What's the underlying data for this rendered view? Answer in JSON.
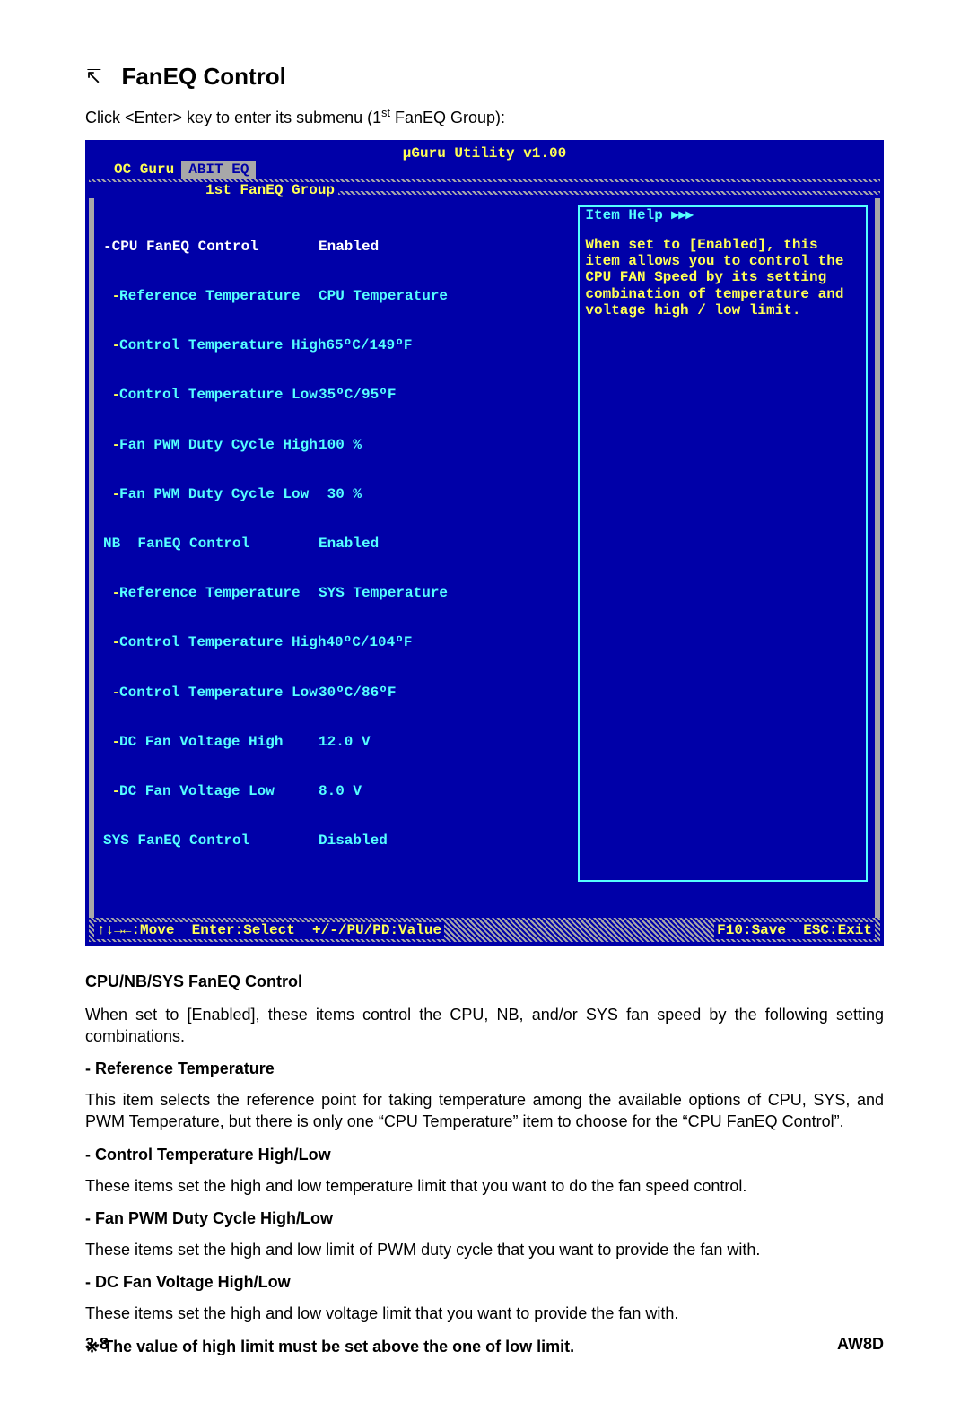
{
  "heading": "FanEQ Control",
  "intro_prefix": "Click <Enter> key to enter its submenu (1",
  "intro_super": "st",
  "intro_suffix": " FanEQ Group):",
  "bios": {
    "title": "μGuru Utility v1.00",
    "tab_inactive": "OC Guru",
    "tab_active": "ABIT EQ",
    "subtitle": "1st FanEQ Group",
    "rows": [
      {
        "indent": "",
        "label": "-CPU FanEQ Control",
        "value": "Enabled",
        "hl": true
      },
      {
        "indent": " - ",
        "label": "Reference Temperature",
        "value": "CPU Temperature"
      },
      {
        "indent": " - ",
        "label": "Control Temperature High",
        "value": "65ºC/149ºF"
      },
      {
        "indent": " - ",
        "label": "Control Temperature Low",
        "value": "35ºC/95ºF"
      },
      {
        "indent": " - ",
        "label": "Fan PWM Duty Cycle High",
        "value": "100 %"
      },
      {
        "indent": " - ",
        "label": "Fan PWM Duty Cycle Low",
        "value": " 30 %"
      },
      {
        "indent": "",
        "label": "NB  FanEQ Control",
        "value": "Enabled"
      },
      {
        "indent": " - ",
        "label": "Reference Temperature",
        "value": "SYS Temperature"
      },
      {
        "indent": " - ",
        "label": "Control Temperature High",
        "value": "40ºC/104ºF"
      },
      {
        "indent": " - ",
        "label": "Control Temperature Low",
        "value": "30ºC/86ºF"
      },
      {
        "indent": " - ",
        "label": "DC Fan Voltage High",
        "value": "12.0 V"
      },
      {
        "indent": " - ",
        "label": "DC Fan Voltage Low",
        "value": "8.0 V"
      },
      {
        "indent": "",
        "label": "SYS FanEQ Control",
        "value": "Disabled"
      }
    ],
    "help_title": "Item Help ▸▸▸",
    "help_body": "When set to [Enabled], this item allows you to control the CPU FAN Speed by its setting combination of temperature and voltage high / low limit.",
    "footer_left": "↑↓→←:Move  Enter:Select  +/-/PU/PD:Value",
    "footer_right": "F10:Save  ESC:Exit"
  },
  "doc": {
    "h_main": "CPU/NB/SYS FanEQ Control",
    "p_main": "When set to [Enabled], these items control the CPU, NB, and/or SYS fan speed by the following setting combinations.",
    "h_ref": "-   Reference Temperature",
    "p_ref": "This item selects the reference point for taking temperature among the available options of CPU, SYS, and PWM Temperature, but there is only one “CPU Temperature” item to choose for the “CPU FanEQ Control”.",
    "h_ctl": "-   Control Temperature High/Low",
    "p_ctl": "These items set the high and low temperature limit that you want to do the fan speed control.",
    "h_pwm": "-   Fan PWM Duty Cycle High/Low",
    "p_pwm": "These items set the high and low limit of PWM duty cycle that you want to provide the fan with.",
    "h_dc": "-   DC Fan Voltage High/Low",
    "p_dc": "These items set the high and low voltage limit that you want to provide the fan with.",
    "note": "※  The value of high limit must be set above the one of low limit."
  },
  "footer": {
    "left": "3-8",
    "right": "AW8D"
  }
}
